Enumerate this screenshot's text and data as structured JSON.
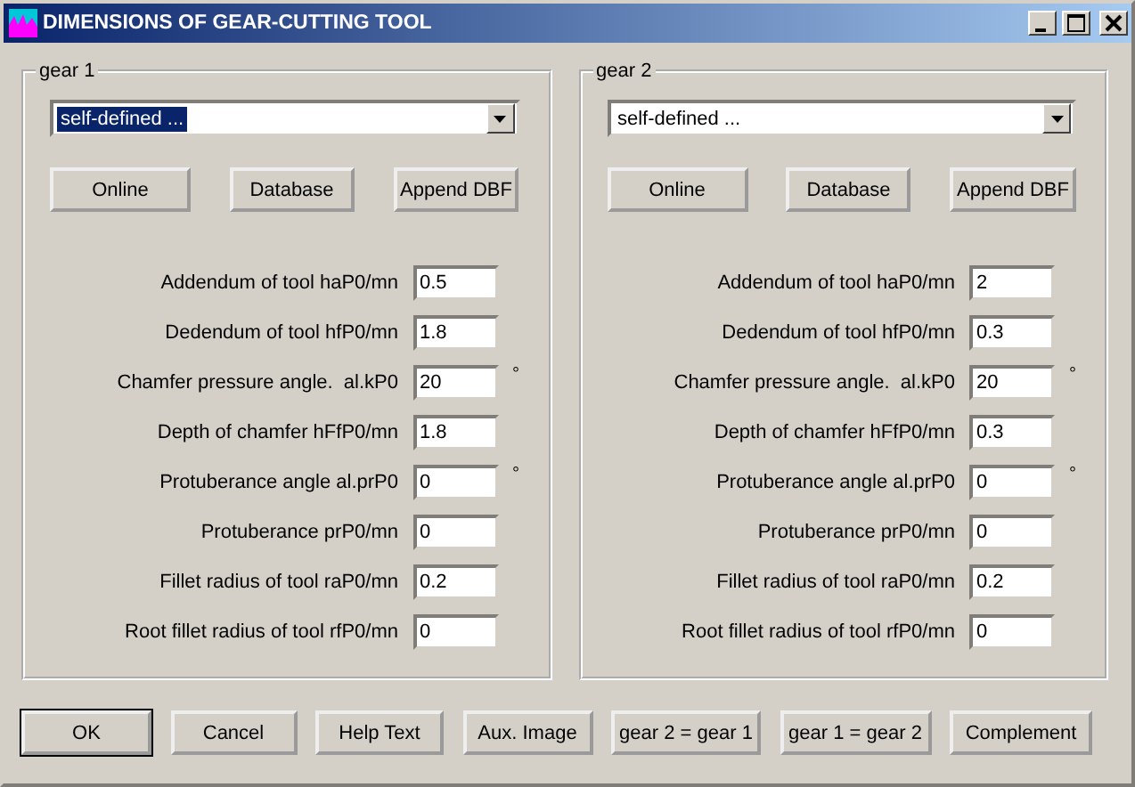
{
  "window": {
    "title": "DIMENSIONS OF GEAR-CUTTING TOOL"
  },
  "groups": [
    {
      "label": "gear 1",
      "combo": {
        "value": "self-defined ...",
        "highlighted": true
      },
      "buttons": [
        "Online",
        "Database",
        "Append DBF"
      ],
      "fields": [
        {
          "label": "Addendum of tool haP0/mn",
          "value": "0.5"
        },
        {
          "label": "Dedendum of tool hfP0/mn",
          "value": "1.8"
        },
        {
          "label": "Chamfer pressure angle.  al.kP0",
          "value": "20",
          "unit": "°"
        },
        {
          "label": "Depth of chamfer hFfP0/mn",
          "value": "1.8"
        },
        {
          "label": "Protuberance angle al.prP0",
          "value": "0",
          "unit": "°"
        },
        {
          "label": "Protuberance prP0/mn",
          "value": "0"
        },
        {
          "label": "Fillet radius of tool raP0/mn",
          "value": "0.2"
        },
        {
          "label": "Root fillet radius of tool rfP0/mn",
          "value": "0"
        }
      ]
    },
    {
      "label": "gear 2",
      "combo": {
        "value": "self-defined ...",
        "highlighted": false
      },
      "buttons": [
        "Online",
        "Database",
        "Append DBF"
      ],
      "fields": [
        {
          "label": "Addendum of tool haP0/mn",
          "value": "2"
        },
        {
          "label": "Dedendum of tool hfP0/mn",
          "value": "0.3"
        },
        {
          "label": "Chamfer pressure angle.  al.kP0",
          "value": "20",
          "unit": "°"
        },
        {
          "label": "Depth of chamfer hFfP0/mn",
          "value": "0.3"
        },
        {
          "label": "Protuberance angle al.prP0",
          "value": "0",
          "unit": "°"
        },
        {
          "label": "Protuberance prP0/mn",
          "value": "0"
        },
        {
          "label": "Fillet radius of tool raP0/mn",
          "value": "0.2"
        },
        {
          "label": "Root fillet radius of tool rfP0/mn",
          "value": "0"
        }
      ]
    }
  ],
  "buttons": [
    {
      "label": "OK",
      "default": true
    },
    {
      "label": "Cancel",
      "default": false
    },
    {
      "label": "Help Text",
      "default": false
    },
    {
      "label": "Aux. Image",
      "default": false
    },
    {
      "label": "gear 2 = gear 1",
      "default": false
    },
    {
      "label": "gear 1 = gear 2",
      "default": false
    },
    {
      "label": "Complement",
      "default": false
    }
  ]
}
